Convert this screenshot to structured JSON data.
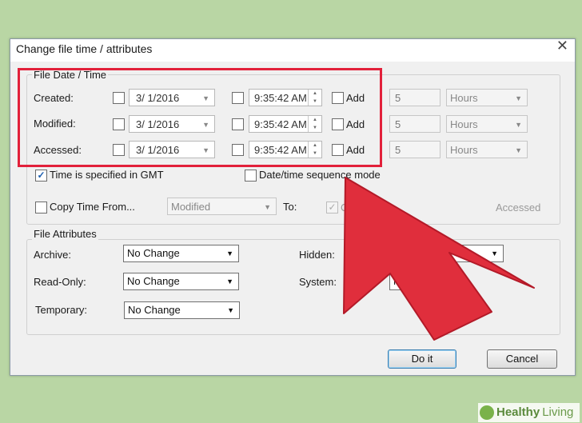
{
  "window": {
    "title": "Change file time / attributes",
    "close_glyph": "✕"
  },
  "date_group": {
    "label": "File Date / Time",
    "rows": [
      {
        "label": "Created:",
        "date": "3/  1/2016",
        "time": "9:35:42 AM",
        "add_label": "Add",
        "amount": "5",
        "unit": "Hours"
      },
      {
        "label": "Modified:",
        "date": "3/  1/2016",
        "time": "9:35:42 AM",
        "add_label": "Add",
        "amount": "5",
        "unit": "Hours"
      },
      {
        "label": "Accessed:",
        "date": "3/  1/2016",
        "time": "9:35:42 AM",
        "add_label": "Add",
        "amount": "5",
        "unit": "Hours"
      }
    ],
    "gmt_label": "Time is specified in GMT",
    "sequence_label": "Date/time sequence mode",
    "copy_label": "Copy Time From...",
    "copy_source": "Modified",
    "to_label": "To:",
    "to_created": "Crea",
    "to_accessed": "Accessed"
  },
  "attr_group": {
    "label": "File Attributes",
    "archive_label": "Archive:",
    "archive_value": "No Change",
    "readonly_label": "Read-Only:",
    "readonly_value": "No Change",
    "temporary_label": "Temporary:",
    "temporary_value": "No Change",
    "hidden_label": "Hidden:",
    "system_label": "System:",
    "system_value": "N"
  },
  "buttons": {
    "doit": "Do it",
    "cancel": "Cancel"
  },
  "watermark": {
    "brand_bold": "Healthy",
    "brand_light": "Living"
  },
  "colors": {
    "highlight": "#e2203a",
    "background": "#b9d6a4",
    "dialog": "#f0f0f0"
  },
  "icons": {
    "checkmark": "✓",
    "dropdown": "▼",
    "spin_up": "▲",
    "spin_down": "▼"
  }
}
